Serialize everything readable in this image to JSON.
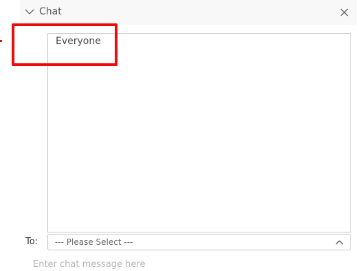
{
  "panel": {
    "title": "Chat",
    "collapse_icon": "chevron-down-icon",
    "close_icon": "close-icon"
  },
  "chat_log": {
    "recipient_header": "Everyone"
  },
  "recipient": {
    "label": "To:",
    "selected": "--- Please Select ---",
    "caret_icon": "chevron-up-icon"
  },
  "message": {
    "placeholder": "Enter chat message here"
  },
  "colors": {
    "highlight": "#ee0b0b",
    "header_bg": "#f8f8f8",
    "border": "#c6c6c6"
  }
}
